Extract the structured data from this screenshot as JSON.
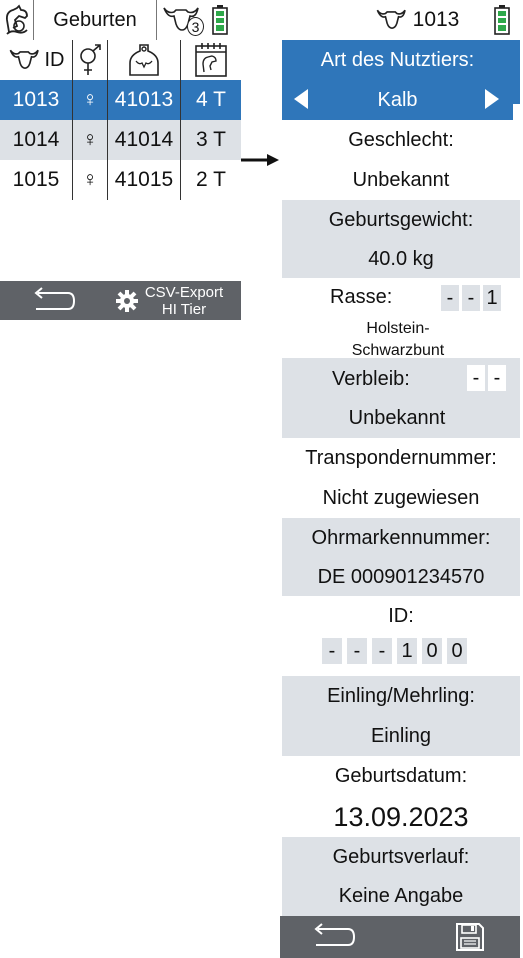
{
  "left": {
    "topbar": {
      "title": "Geburten",
      "herd_count": "3"
    },
    "table": {
      "columns": [
        "ID",
        "sex-icon",
        "ear-tag-icon",
        "calendar-icon"
      ],
      "header_id_label": "ID",
      "rows": [
        {
          "id": "1013",
          "sex": "♀",
          "tag": "41013",
          "age": "4 T",
          "selected": true
        },
        {
          "id": "1014",
          "sex": "♀",
          "tag": "41014",
          "age": "3 T",
          "selected": false
        },
        {
          "id": "1015",
          "sex": "♀",
          "tag": "41015",
          "age": "2 T",
          "selected": false
        }
      ]
    },
    "bottom": {
      "csv_line1": "CSV-Export",
      "csv_line2": "HI Tier"
    }
  },
  "right": {
    "topbar": {
      "animal_id": "1013"
    },
    "animal_type": {
      "label": "Art des Nutztiers:",
      "value": "Kalb"
    },
    "sex": {
      "label": "Geschlecht:",
      "value": "Unbekannt"
    },
    "birth_weight": {
      "label": "Geburtsgewicht:",
      "value": "40.0 kg"
    },
    "breed": {
      "label": "Rasse:",
      "code": [
        "-",
        "-",
        "1"
      ],
      "value_line1": "Holstein-",
      "value_line2": "Schwarzbunt"
    },
    "whereabouts": {
      "label": "Verbleib:",
      "code": [
        "-",
        "-"
      ],
      "value": "Unbekannt"
    },
    "transponder": {
      "label": "Transpondernummer:",
      "value": "Nicht zugewiesen"
    },
    "ear_tag": {
      "label": "Ohrmarkennummer:",
      "value": "DE 000901234570"
    },
    "id_field": {
      "label": "ID:",
      "digits": [
        "-",
        "-",
        "-",
        "1",
        "0",
        "0"
      ]
    },
    "birth_type": {
      "label": "Einling/Mehrling:",
      "value": "Einling"
    },
    "birth_date": {
      "label": "Geburtsdatum:",
      "value": "13.09.2023"
    },
    "birth_course": {
      "label": "Geburtsverlauf:",
      "value": "Keine Angabe"
    }
  },
  "colors": {
    "selection_blue": "#2f76ba",
    "row_gray": "#dde1e6",
    "bar_gray": "#5f6267",
    "battery_green": "#2ea84a"
  }
}
